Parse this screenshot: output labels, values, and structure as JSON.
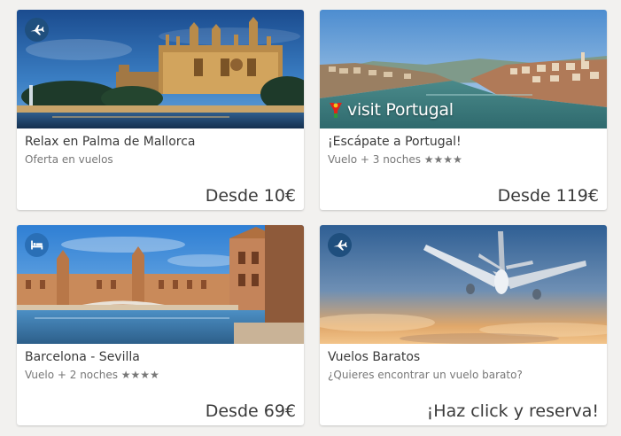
{
  "cards": [
    {
      "title": "Relax en Palma de Mallorca",
      "subtitle": "Oferta en vuelos",
      "price": "Desde 10€",
      "badge_icon": "plane-icon",
      "image": "palma-cathedral-at-dusk"
    },
    {
      "title": "¡Escápate a Portugal!",
      "subtitle": "Vuelo + 3 noches ★★★★",
      "price": "Desde 119€",
      "badge_icon": "none",
      "image": "porto-river-view",
      "brand_text": "visit Portugal"
    },
    {
      "title": "Barcelona - Sevilla",
      "subtitle": "Vuelo + 2 noches ★★★★",
      "price": "Desde 69€",
      "badge_icon": "bed-icon",
      "image": "plaza-de-espana-sevilla"
    },
    {
      "title": "Vuelos Baratos",
      "subtitle": "¿Quieres encontrar un vuelo barato?",
      "price": "¡Haz click y reserva!",
      "badge_icon": "plane-icon",
      "image": "airplane-in-sky"
    }
  ],
  "colors": {
    "background": "#f2f1ef",
    "badge": "#1f4f7e",
    "text": "#3a3a3a",
    "muted": "#777777"
  }
}
